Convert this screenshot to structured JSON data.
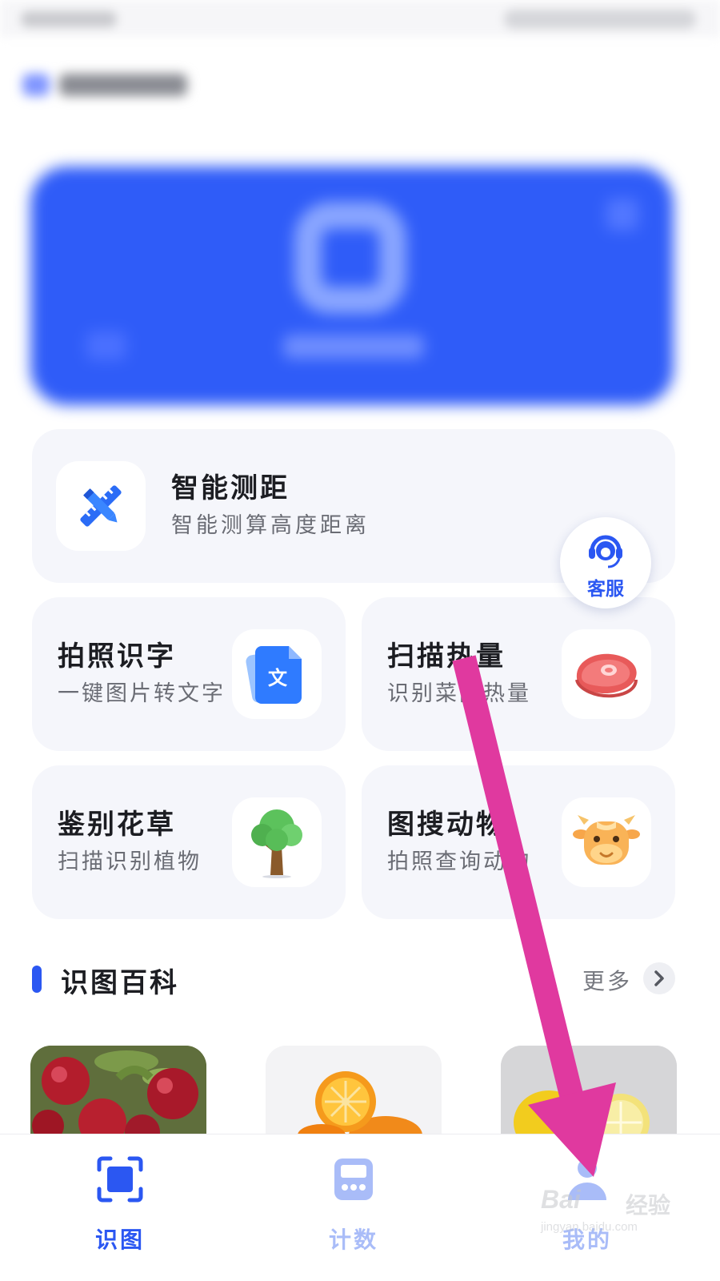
{
  "feature_wide": {
    "title": "智能测距",
    "subtitle": "智能测算高度距离",
    "icon": "ruler-pencil-icon"
  },
  "features": [
    {
      "title": "拍照识字",
      "subtitle": "一键图片转文字",
      "icon": "document-text-icon"
    },
    {
      "title": "扫描热量",
      "subtitle": "识别菜品热量",
      "icon": "steak-icon"
    },
    {
      "title": "鉴别花草",
      "subtitle": "扫描识别植物",
      "icon": "tree-icon"
    },
    {
      "title": "图搜动物",
      "subtitle": "拍照查询动物",
      "icon": "cow-icon"
    }
  ],
  "service": {
    "label": "客服",
    "icon": "customer-service-icon"
  },
  "section": {
    "title": "识图百科",
    "more": "更多"
  },
  "thumbnails": [
    {
      "subject": "apple"
    },
    {
      "subject": "orange"
    },
    {
      "subject": "lemon"
    }
  ],
  "tabs": [
    {
      "label": "识图",
      "icon": "scan-icon",
      "active": true
    },
    {
      "label": "计数",
      "icon": "counter-icon",
      "active": false
    },
    {
      "label": "我的",
      "icon": "profile-icon",
      "active": false
    }
  ],
  "colors": {
    "accent": "#2b57f2",
    "card_bg": "#f5f6fb",
    "inactive_tab": "#a9bcf8",
    "annotation_arrow": "#e0399f"
  },
  "watermark": {
    "logo": "Bai",
    "cn": "经验",
    "url": "jingyan.baidu.com"
  }
}
